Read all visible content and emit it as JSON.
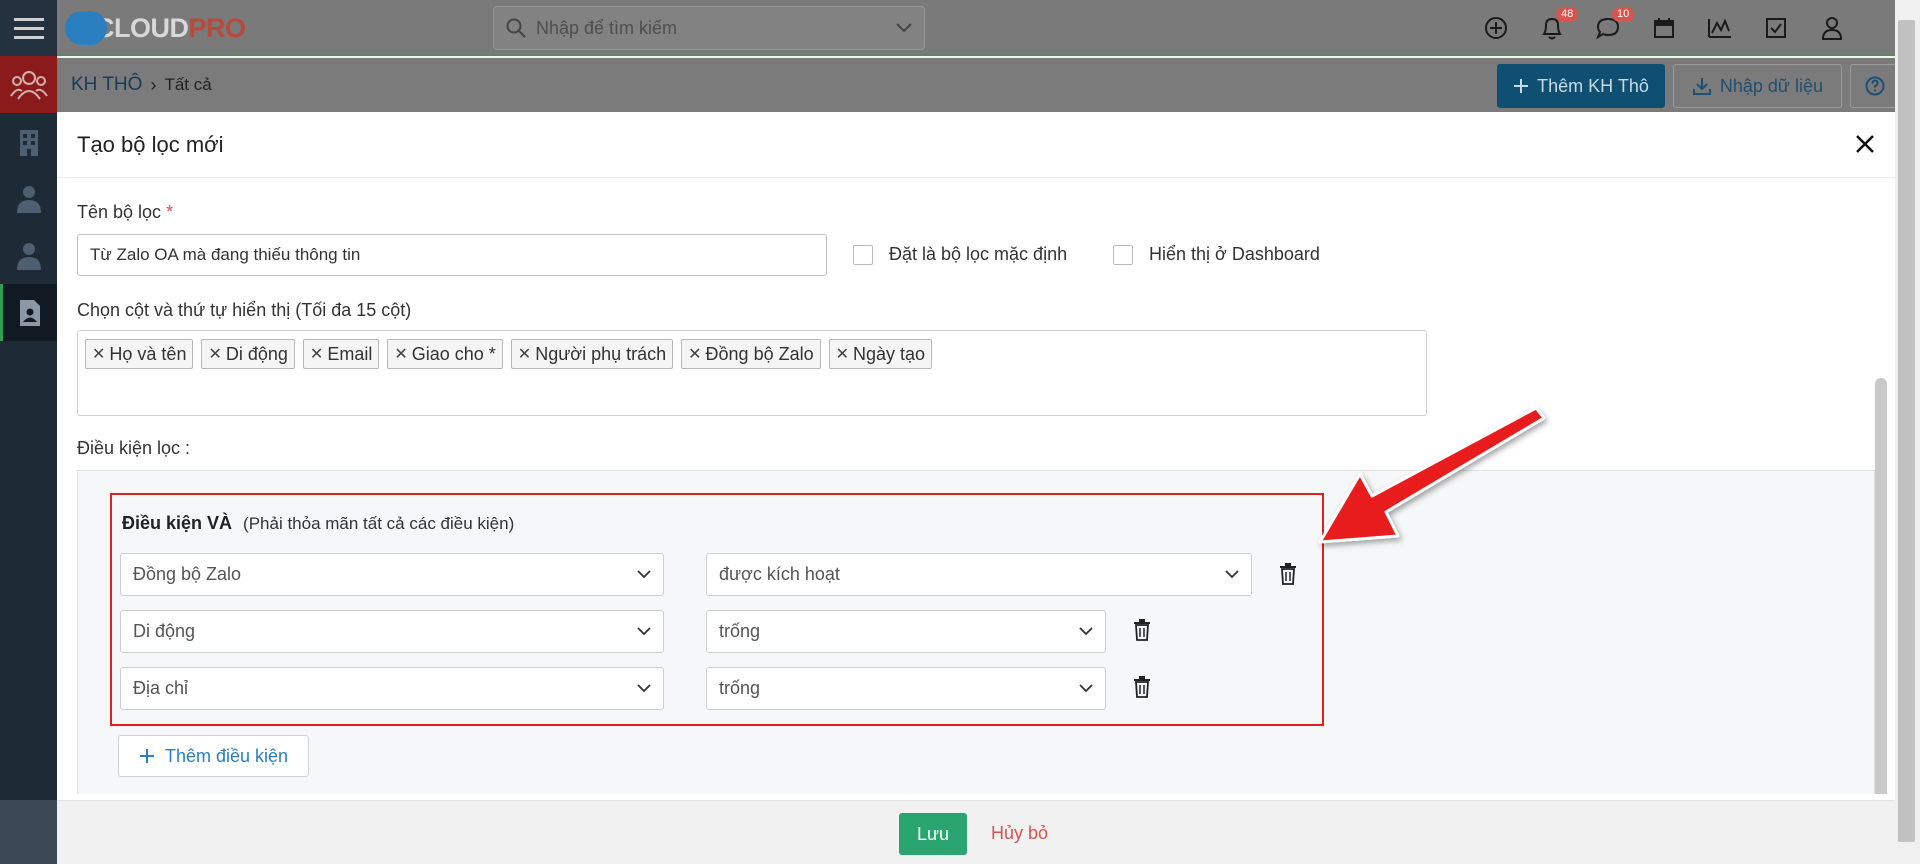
{
  "app": {
    "logo_main": "CLOUD",
    "logo_accent": "PRO"
  },
  "search": {
    "placeholder": "Nhập để tìm kiếm"
  },
  "notifications": {
    "bell_count": "48",
    "chat_count": "10"
  },
  "breadcrumb": {
    "module": "KH THÔ",
    "current": "Tất cả"
  },
  "toolbar": {
    "add_label": "Thêm KH Thô",
    "import_label": "Nhập dữ liệu"
  },
  "modal": {
    "title": "Tạo bộ lọc mới",
    "filter_name_label": "Tên bộ lọc",
    "required_mark": "*",
    "filter_name_value": "Từ Zalo OA mà đang thiếu thông tin",
    "default_check_label": "Đặt là bộ lọc mặc định",
    "dashboard_check_label": "Hiển thị ở Dashboard",
    "columns_label": "Chọn cột và thứ tự hiển thị (Tối đa 15 cột)",
    "columns": [
      {
        "label": "Họ và tên"
      },
      {
        "label": "Di động"
      },
      {
        "label": "Email"
      },
      {
        "label": "Giao cho *"
      },
      {
        "label": "Người phụ trách"
      },
      {
        "label": "Đồng bộ Zalo"
      },
      {
        "label": "Ngày tạo"
      }
    ],
    "conditions_label": "Điều kiện lọc :",
    "and_group": {
      "title": "Điều kiện VÀ",
      "hint": "(Phải thỏa mãn tất cả các điều kiện)",
      "rows": [
        {
          "field": "Đồng bộ Zalo",
          "operator": "được kích hoạt"
        },
        {
          "field": "Di động",
          "operator": "trống"
        },
        {
          "field": "Địa chỉ",
          "operator": "trống"
        }
      ]
    },
    "add_condition_label": "Thêm điều kiện",
    "save_label": "Lưu",
    "cancel_label": "Hủy bỏ"
  },
  "colors": {
    "sidebar_bg": "#1e2a36",
    "primary": "#0f4f72",
    "save_green": "#2aa56f",
    "cancel_red": "#d9534f",
    "highlight_red": "#e02020",
    "link_blue": "#2a7fc0"
  }
}
